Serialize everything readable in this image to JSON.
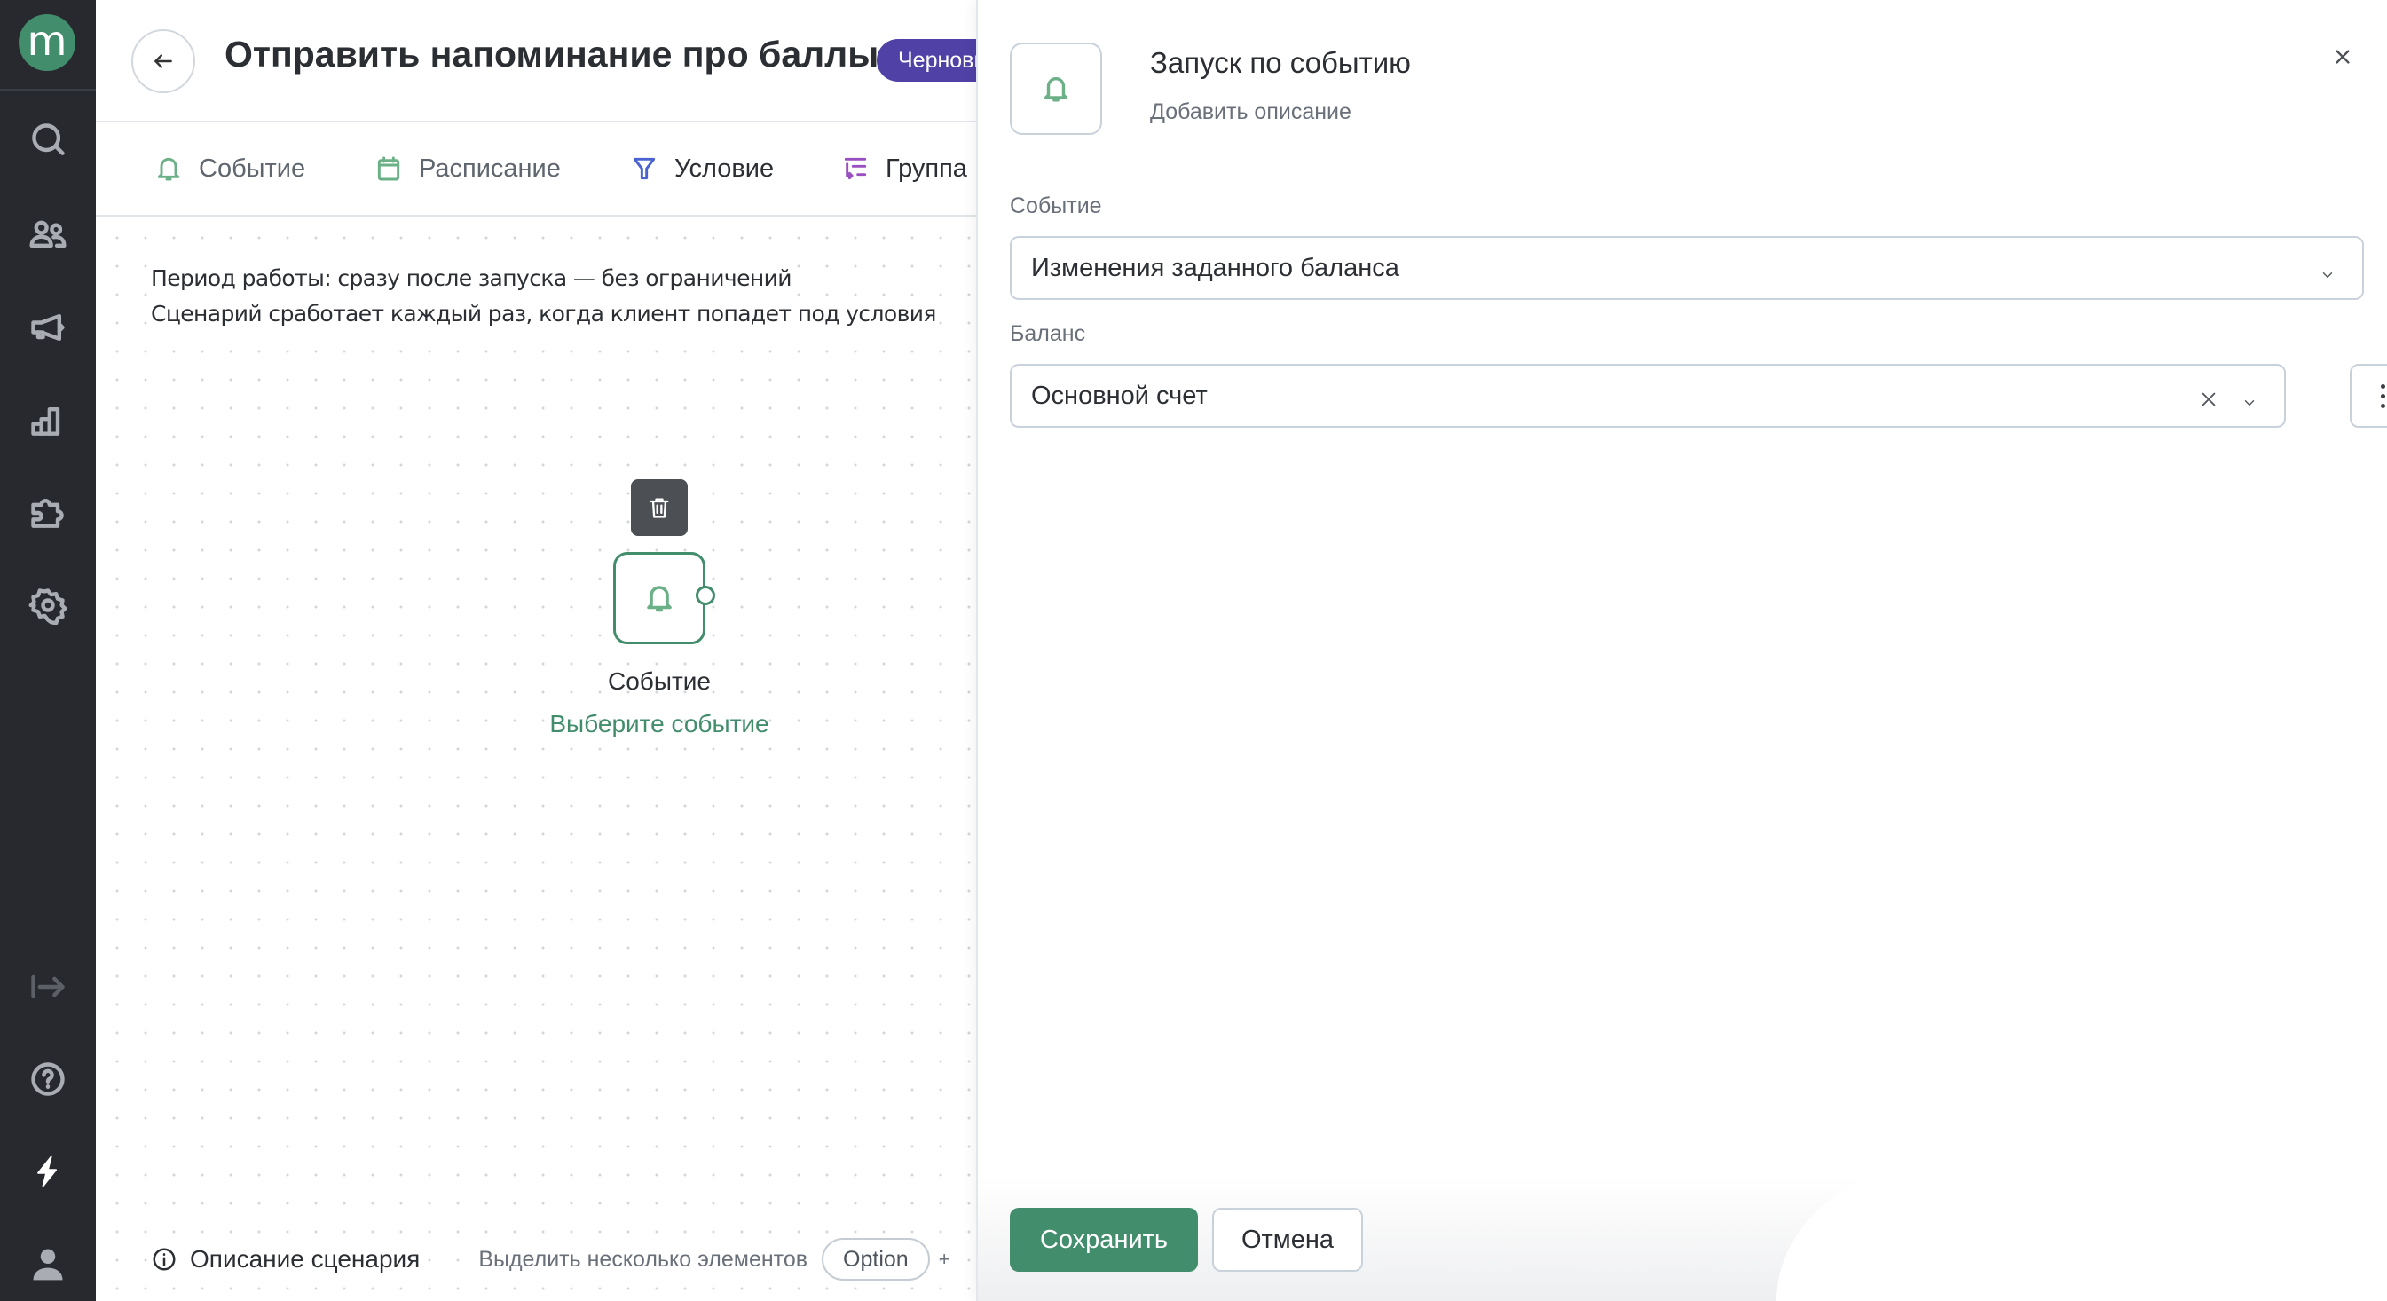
{
  "sidebar": {
    "logo_letter": "m",
    "logo_color": "#418d6c",
    "items": [
      {
        "name": "search",
        "icon": "search-icon"
      },
      {
        "name": "clients",
        "icon": "users-icon"
      },
      {
        "name": "campaigns",
        "icon": "megaphone-icon"
      },
      {
        "name": "analytics",
        "icon": "bar-chart-icon"
      },
      {
        "name": "integrations",
        "icon": "puzzle-icon"
      },
      {
        "name": "settings",
        "icon": "gear-icon"
      }
    ],
    "bottom_items": [
      {
        "name": "expand",
        "icon": "expand-arrow-icon"
      },
      {
        "name": "help",
        "icon": "help-icon"
      },
      {
        "name": "updates",
        "icon": "lightning-icon"
      },
      {
        "name": "profile",
        "icon": "user-icon"
      }
    ]
  },
  "header": {
    "title": "Отправить напоминание про баллы",
    "status_badge": "Черновик",
    "badge_color": "#4f41a6"
  },
  "tabs": [
    {
      "label": "Событие",
      "icon": "bell-icon",
      "color": "#6bb087",
      "text_color": "#5f666e"
    },
    {
      "label": "Расписание",
      "icon": "calendar-icon",
      "color": "#6bb087",
      "text_color": "#5f666e"
    },
    {
      "label": "Условие",
      "icon": "filter-icon",
      "color": "#4a63d0",
      "text_color": "#2b2e33"
    },
    {
      "label": "Группа",
      "icon": "group-icon",
      "color": "#9a4fc0",
      "text_color": "#2b2e33"
    }
  ],
  "canvas": {
    "info_line_1": "Период работы: сразу после запуска — без ограничений",
    "info_line_2": "Сценарий сработает каждый раз, когда клиент попадет под условия",
    "node": {
      "title": "Событие",
      "link": "Выберите событие"
    },
    "bottom": {
      "description_label": "Описание сценария",
      "multiselect_hint": "Выделить несколько элементов",
      "key": "Option",
      "plus": "+"
    }
  },
  "drawer": {
    "title": "Запуск по событию",
    "add_description": "Добавить описание",
    "event_label": "Событие",
    "event_value": "Изменения заданного баланса",
    "balance_label": "Баланс",
    "balance_value": "Основной счет",
    "save_label": "Сохранить",
    "cancel_label": "Отмена",
    "accent_color": "#418d6c"
  }
}
